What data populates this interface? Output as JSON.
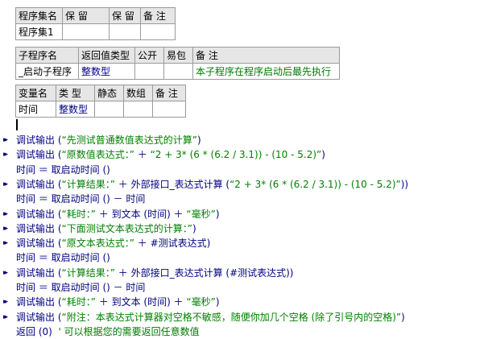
{
  "assembly_table": {
    "headers": [
      "程序集名",
      "保 留",
      "保 留",
      "备 注"
    ],
    "row": [
      "程序集1",
      "",
      "",
      ""
    ]
  },
  "sub_table": {
    "headers": [
      "子程序名",
      "返回值类型",
      "公开",
      "易包",
      "备 注"
    ],
    "row": [
      "_启动子程序",
      "整数型",
      "",
      "",
      "本子程序在程序启动后最先执行"
    ]
  },
  "var_table": {
    "headers": [
      "变量名",
      "类 型",
      "静态",
      "数组",
      "备 注"
    ],
    "row": [
      "时间",
      "整数型",
      "",
      "",
      ""
    ]
  },
  "code_lines": [
    {
      "arrow": true,
      "text": "调试输出 (“先测试普通数值表达式的计算”)"
    },
    {
      "arrow": true,
      "text": "调试输出 (“原数值表达式：” ＋ “2 + 3* (6 * (6.2 / 3.1)) - (10 - 5.2)”)"
    },
    {
      "arrow": false,
      "text": "时间 ＝ 取启动时间 ()"
    },
    {
      "arrow": true,
      "text": "调试输出 (“计算结果：” ＋ 外部接口_表达式计算 (“2 + 3* (6 * (6.2 / 3.1)) - (10 - 5.2)”))"
    },
    {
      "arrow": false,
      "text": "时间 ＝ 取启动时间 () － 时间"
    },
    {
      "arrow": true,
      "text": "调试输出 (“耗时：” ＋ 到文本 (时间) ＋ “毫秒”)"
    },
    {
      "arrow": true,
      "text": "调试输出 (“下面测试文本表达式的计算：”)"
    },
    {
      "arrow": true,
      "text": "调试输出 (“原文本表达式：” ＋ #测试表达式)"
    },
    {
      "arrow": false,
      "text": "时间 ＝ 取启动时间 ()"
    },
    {
      "arrow": true,
      "text": "调试输出 (“计算结果：” ＋ 外部接口_表达式计算 (#测试表达式))"
    },
    {
      "arrow": false,
      "text": "时间 ＝ 取启动时间 () － 时间"
    },
    {
      "arrow": true,
      "text": "调试输出 (“耗时：” ＋ 到文本 (时间) ＋ “毫秒”)"
    },
    {
      "arrow": true,
      "text": "调试输出 (“附注：本表达式计算器对空格不敏感，随便你加几个空格 (除了引号内的空格)”)"
    },
    {
      "arrow": false,
      "text": "返回 (0)  ' 可以根据您的需要返回任意数值"
    }
  ],
  "colors": {
    "command": "#000080",
    "string": "#008000",
    "comment": "#007800",
    "header_bg": "#e6e6e6"
  },
  "icons": {
    "line_marker": "double-chevron-right-icon"
  }
}
